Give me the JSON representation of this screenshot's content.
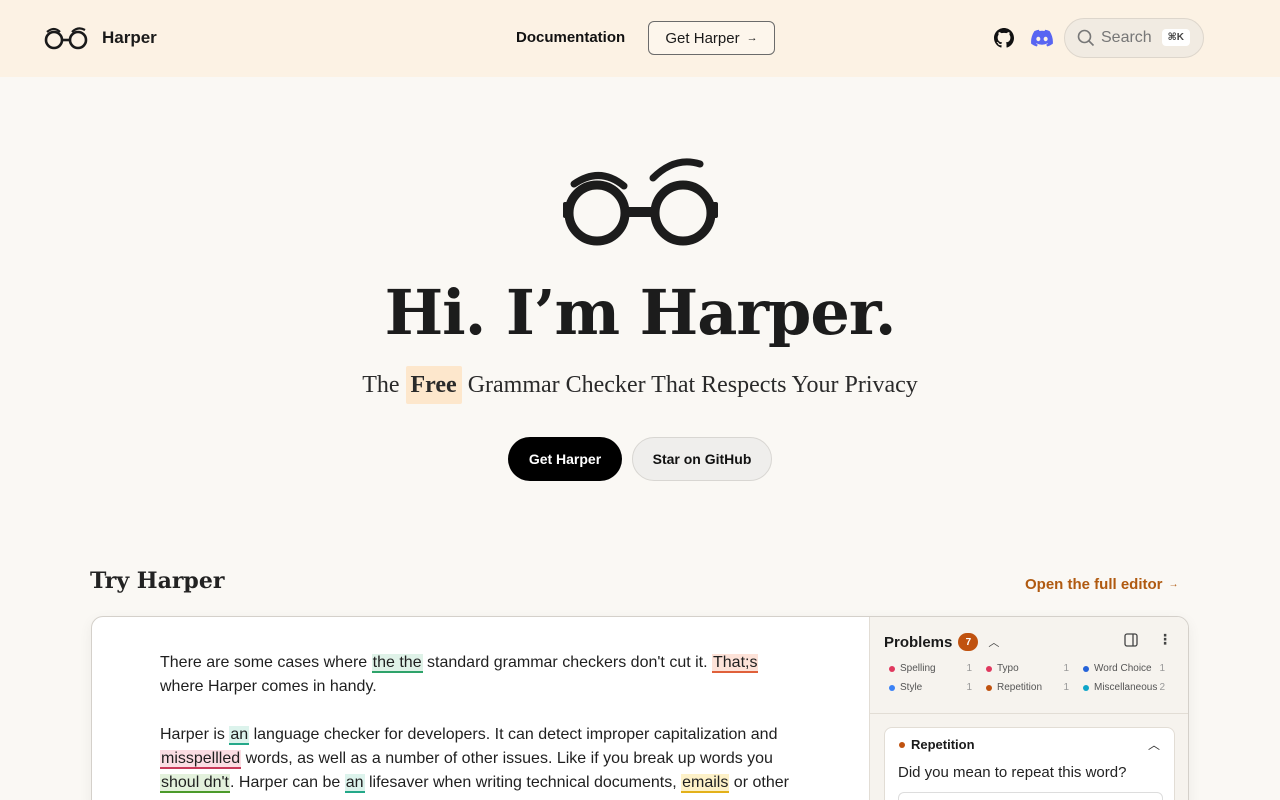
{
  "header": {
    "brand": "Harper",
    "nav_documentation": "Documentation",
    "nav_get": "Get Harper",
    "nav_get_arrow": "→",
    "search_placeholder": "Search",
    "search_shortcut": "⌘K"
  },
  "hero": {
    "title": "Hi. I’m Harper.",
    "tagline_pre": "The",
    "tagline_highlight": "Free",
    "tagline_post": "Grammar Checker That Respects Your Privacy",
    "primary_button": "Get Harper",
    "secondary_button": "Star on GitHub"
  },
  "try": {
    "title": "Try Harper",
    "open_editor": "Open the full editor",
    "open_editor_arrow": "→"
  },
  "editor": {
    "p1": {
      "a": "There are some cases where ",
      "h1": "the the",
      "b": " standard grammar checkers don't cut it. ",
      "h2": "That;s",
      "c": " where Harper comes in handy."
    },
    "p2": {
      "a": "Harper is ",
      "h1": "an",
      "b": " language checker for developers. It can detect improper capitalization and ",
      "h2": "misspellled",
      "c": " words, as well as a number of other issues. Like if you break up words you ",
      "h3": "shoul dn't",
      "d": ". Harper can be ",
      "h4": "an",
      "e": " lifesaver when writing technical documents, ",
      "h5": "emails",
      "f": " or other"
    }
  },
  "problems": {
    "title": "Problems",
    "count": "7",
    "categories": [
      {
        "label": "Spelling",
        "count": "1",
        "color": "#e0385e"
      },
      {
        "label": "Typo",
        "count": "1",
        "color": "#e0385e"
      },
      {
        "label": "Word Choice",
        "count": "1",
        "color": "#2563d9"
      },
      {
        "label": "Style",
        "count": "1",
        "color": "#3b82f6"
      },
      {
        "label": "Repetition",
        "count": "1",
        "color": "#c0520f"
      },
      {
        "label": "Miscellaneous",
        "count": "2",
        "color": "#0ea5c9"
      }
    ],
    "card": {
      "title": "Repetition",
      "question": "Did you mean to repeat this word?",
      "dot_color": "#c0520f"
    }
  },
  "colors": {
    "header_bg": "#fcf2e4",
    "page_bg": "#faf8f4",
    "accent": "#b05a10"
  }
}
